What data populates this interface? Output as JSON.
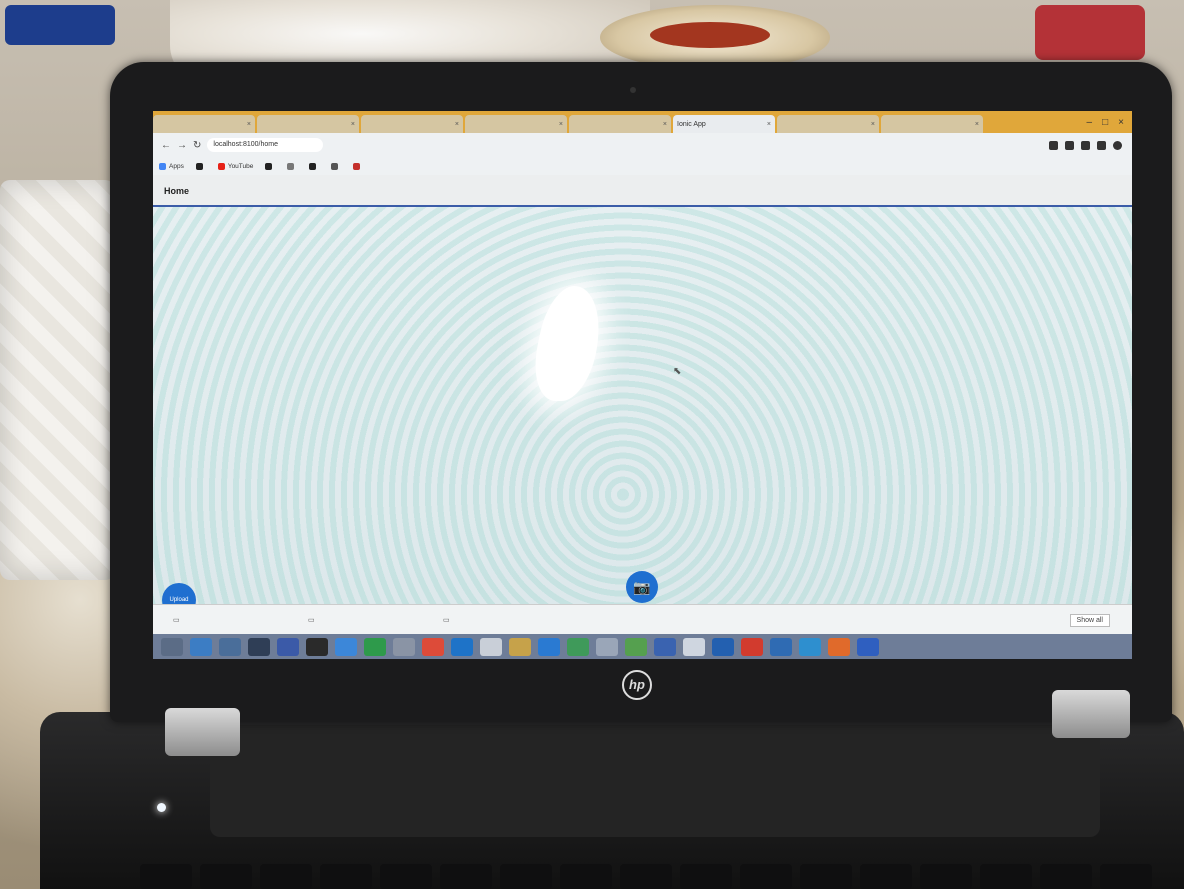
{
  "browser": {
    "tabs": [
      {
        "label": "",
        "active": false
      },
      {
        "label": "",
        "active": false
      },
      {
        "label": "",
        "active": false
      },
      {
        "label": "",
        "active": false
      },
      {
        "label": "",
        "active": false
      },
      {
        "label": "Ionic App",
        "active": true
      },
      {
        "label": "",
        "active": false
      },
      {
        "label": "",
        "active": false
      }
    ],
    "url": "localhost:8100/home",
    "bookmarks": [
      {
        "label": "Apps",
        "color": "#4285f4"
      },
      {
        "label": "",
        "color": "#222222"
      },
      {
        "label": "YouTube",
        "color": "#e62117"
      },
      {
        "label": "",
        "color": "#222222"
      },
      {
        "label": "",
        "color": "#777777"
      },
      {
        "label": "",
        "color": "#222222"
      },
      {
        "label": "",
        "color": "#555555"
      },
      {
        "label": "",
        "color": "#c4302b"
      }
    ]
  },
  "app": {
    "title": "Home",
    "fab_left_label": "Upload",
    "fab_camera_icon": "camera-icon",
    "accent": "#1f6fd0"
  },
  "downloads": {
    "items": [
      {
        "name": ""
      },
      {
        "name": ""
      },
      {
        "name": ""
      }
    ],
    "show_all": "Show all"
  },
  "taskbar": {
    "apps": [
      "start",
      "ie",
      "explorer",
      "store",
      "media",
      "hp",
      "app",
      "app",
      "app",
      "chrome",
      "app",
      "app",
      "app",
      "app",
      "app",
      "app",
      "app",
      "app",
      "app",
      "app",
      "acrobat",
      "app",
      "app",
      "app",
      "help"
    ]
  },
  "laptop": {
    "brand": "hp"
  }
}
